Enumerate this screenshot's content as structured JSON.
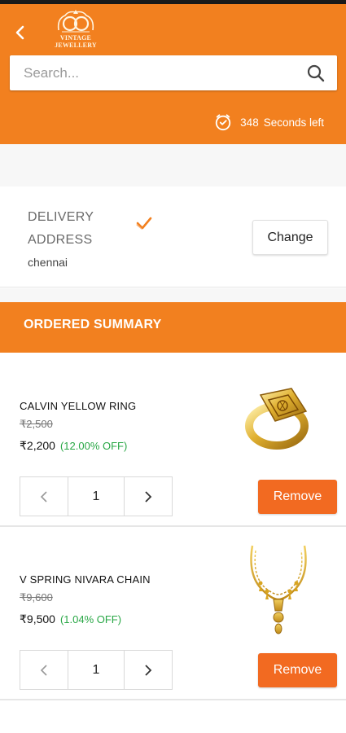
{
  "header": {
    "logo_line1": "VINTAGE",
    "logo_line2": "JEWELLERY",
    "search_placeholder": "Search...",
    "timer_seconds": "348",
    "timer_label": "Seconds left",
    "accent": "#f2801f"
  },
  "address": {
    "label_line1": "DELIVERY",
    "label_line2": "ADDRESS",
    "city": "chennai",
    "change_label": "Change",
    "check_color": "#f2801f"
  },
  "summary": {
    "title": "ORDERED SUMMARY"
  },
  "items": [
    {
      "name": "CALVIN YELLOW RING",
      "old_price": "₹2,500",
      "price": "₹2,200",
      "discount": "(12.00% OFF)",
      "qty": "1",
      "remove_label": "Remove",
      "image": "gold-ring"
    },
    {
      "name": "V SPRING NIVARA CHAIN",
      "old_price": "₹9,600",
      "price": "₹9,500",
      "discount": "(1.04% OFF)",
      "qty": "1",
      "remove_label": "Remove",
      "image": "gold-necklace"
    }
  ],
  "colors": {
    "header_bg": "#f2801f",
    "remove_bg": "#f26a21",
    "discount_text": "#28a745"
  }
}
